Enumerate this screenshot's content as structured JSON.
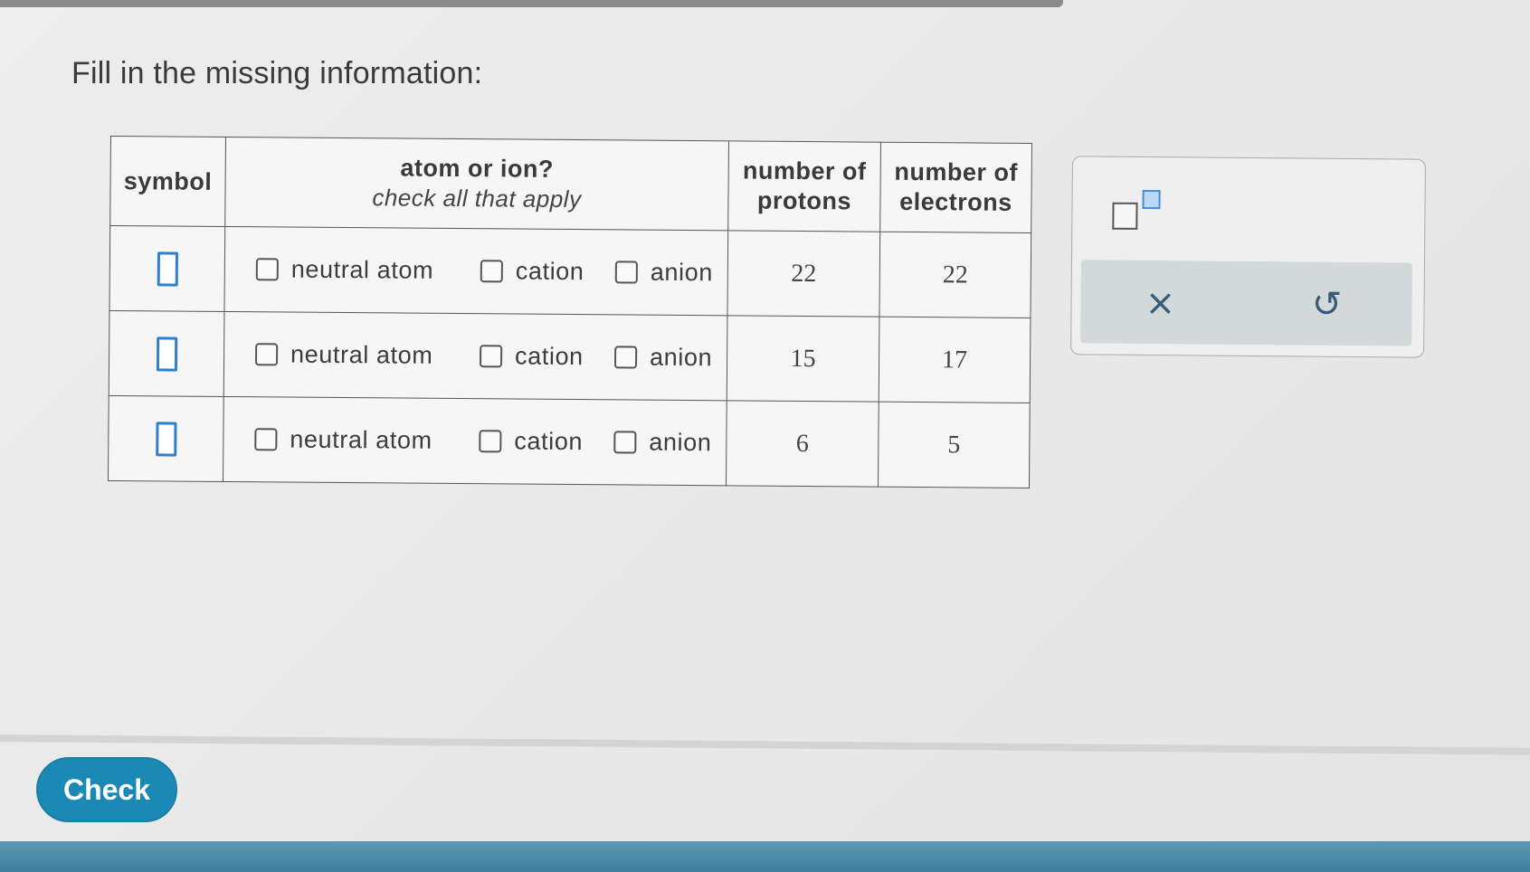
{
  "prompt": "Fill in the missing information:",
  "table": {
    "headers": {
      "symbol": "symbol",
      "kind_title": "atom or ion?",
      "kind_sub": "check all that apply",
      "protons": "number of protons",
      "electrons": "number of electrons"
    },
    "option_labels": {
      "neutral": "neutral atom",
      "cation": "cation",
      "anion": "anion"
    },
    "rows": [
      {
        "protons": "22",
        "electrons": "22"
      },
      {
        "protons": "15",
        "electrons": "17"
      },
      {
        "protons": "6",
        "electrons": "5"
      }
    ]
  },
  "tools": {
    "clear_symbol": "×",
    "undo_symbol": "↺",
    "superscript_icon": "superscript-template-icon"
  },
  "footer": {
    "check_label": "Check"
  },
  "colors": {
    "accent": "#1a8ab4",
    "input_border": "#2f7fd0",
    "tool_icon": "#355c7a"
  }
}
